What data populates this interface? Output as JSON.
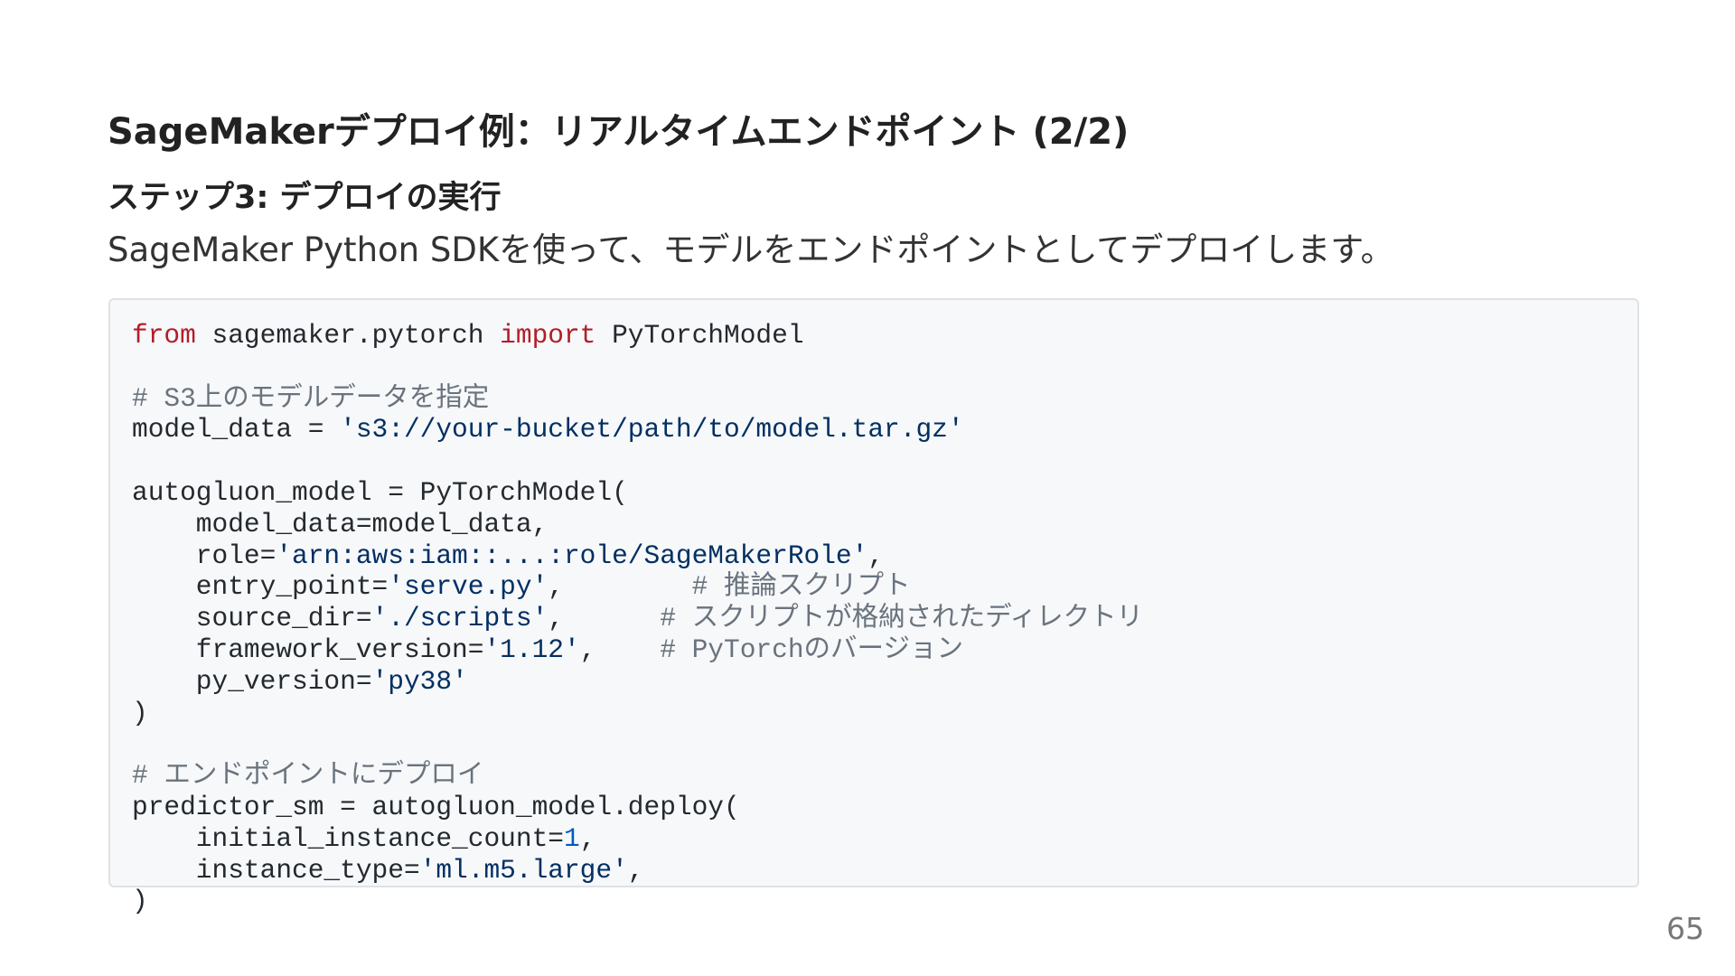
{
  "slide": {
    "title": "SageMakerデプロイ例：リアルタイムエンドポイント (2/2)",
    "section_heading": "ステップ3: デプロイの実行",
    "description": "SageMaker Python SDKを使って、モデルをエンドポイントとしてデプロイします。",
    "page_number": "65"
  },
  "code": {
    "language": "python",
    "lines": [
      [
        {
          "t": "kw",
          "v": "from"
        },
        {
          "t": "plain",
          "v": " sagemaker.pytorch "
        },
        {
          "t": "kw",
          "v": "import"
        },
        {
          "t": "plain",
          "v": " PyTorchModel"
        }
      ],
      [],
      [
        {
          "t": "comment",
          "v": "# S3上のモデルデータを指定"
        }
      ],
      [
        {
          "t": "plain",
          "v": "model_data = "
        },
        {
          "t": "str",
          "v": "'s3://your-bucket/path/to/model.tar.gz'"
        }
      ],
      [],
      [
        {
          "t": "plain",
          "v": "autogluon_model = PyTorchModel("
        }
      ],
      [
        {
          "t": "plain",
          "v": "    model_data=model_data,"
        }
      ],
      [
        {
          "t": "plain",
          "v": "    role="
        },
        {
          "t": "str",
          "v": "'arn:aws:iam::...:role/SageMakerRole'"
        },
        {
          "t": "plain",
          "v": ","
        }
      ],
      [
        {
          "t": "plain",
          "v": "    entry_point="
        },
        {
          "t": "str",
          "v": "'serve.py'"
        },
        {
          "t": "plain",
          "v": ",        "
        },
        {
          "t": "comment",
          "v": "# 推論スクリプト"
        }
      ],
      [
        {
          "t": "plain",
          "v": "    source_dir="
        },
        {
          "t": "str",
          "v": "'./scripts'"
        },
        {
          "t": "plain",
          "v": ",      "
        },
        {
          "t": "comment",
          "v": "# スクリプトが格納されたディレクトリ"
        }
      ],
      [
        {
          "t": "plain",
          "v": "    framework_version="
        },
        {
          "t": "str",
          "v": "'1.12'"
        },
        {
          "t": "plain",
          "v": ",    "
        },
        {
          "t": "comment",
          "v": "# PyTorchのバージョン"
        }
      ],
      [
        {
          "t": "plain",
          "v": "    py_version="
        },
        {
          "t": "str",
          "v": "'py38'"
        }
      ],
      [
        {
          "t": "plain",
          "v": ")"
        }
      ],
      [],
      [
        {
          "t": "comment",
          "v": "# エンドポイントにデプロイ"
        }
      ],
      [
        {
          "t": "plain",
          "v": "predictor_sm = autogluon_model.deploy("
        }
      ],
      [
        {
          "t": "plain",
          "v": "    initial_instance_count="
        },
        {
          "t": "num",
          "v": "1"
        },
        {
          "t": "plain",
          "v": ","
        }
      ],
      [
        {
          "t": "plain",
          "v": "    instance_type="
        },
        {
          "t": "str",
          "v": "'ml.m5.large'"
        },
        {
          "t": "plain",
          "v": ","
        }
      ],
      [
        {
          "t": "plain",
          "v": ")"
        }
      ]
    ]
  },
  "colors": {
    "keyword": "#b31d28",
    "string": "#032f62",
    "number": "#005cc5",
    "comment": "#6a737d",
    "code_background": "#f6f8fa"
  }
}
